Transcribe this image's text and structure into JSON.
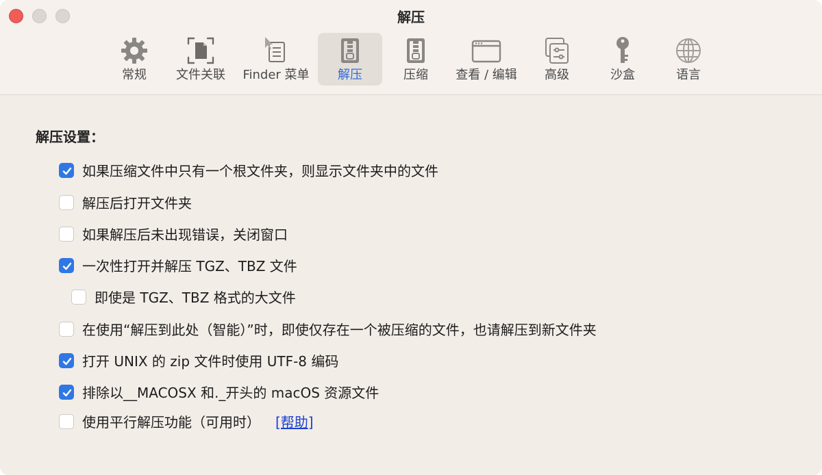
{
  "window": {
    "title": "解压"
  },
  "toolbar": {
    "tabs": [
      {
        "label": "常规",
        "icon": "gear-icon"
      },
      {
        "label": "文件关联",
        "icon": "file-association-icon"
      },
      {
        "label": "Finder 菜单",
        "icon": "finder-menu-icon"
      },
      {
        "label": "解压",
        "icon": "extract-zip-icon",
        "active": true
      },
      {
        "label": "压缩",
        "icon": "compress-zip-icon"
      },
      {
        "label": "查看 / 编辑",
        "icon": "view-edit-window-icon"
      },
      {
        "label": "高级",
        "icon": "advanced-sliders-icon"
      },
      {
        "label": "沙盒",
        "icon": "key-icon"
      },
      {
        "label": "语言",
        "icon": "globe-icon"
      }
    ]
  },
  "settings": {
    "title": "解压设置：",
    "options": [
      {
        "label": "如果压缩文件中只有一个根文件夹，则显示文件夹中的文件",
        "checked": true
      },
      {
        "label": "解压后打开文件夹",
        "checked": false
      },
      {
        "label": "如果解压后未出现错误，关闭窗口",
        "checked": false
      },
      {
        "label": "一次性打开并解压 TGZ、TBZ 文件",
        "checked": true
      },
      {
        "label": "即使是 TGZ、TBZ 格式的大文件",
        "checked": false
      },
      {
        "label": "在使用“解压到此处（智能）”时，即使仅存在一个被压缩的文件，也请解压到新文件夹",
        "checked": false
      },
      {
        "label": "打开 UNIX 的 zip 文件时使用 UTF-8 编码",
        "checked": true
      },
      {
        "label": "排除以__MACOSX 和._开头的 macOS 资源文件",
        "checked": true
      },
      {
        "label": "使用平行解压功能（可用时）",
        "checked": false
      }
    ],
    "help_link": "[帮助]"
  },
  "colors": {
    "accent": "#2f78e4",
    "link": "#1a3fd0",
    "close": "#ee5d57"
  }
}
